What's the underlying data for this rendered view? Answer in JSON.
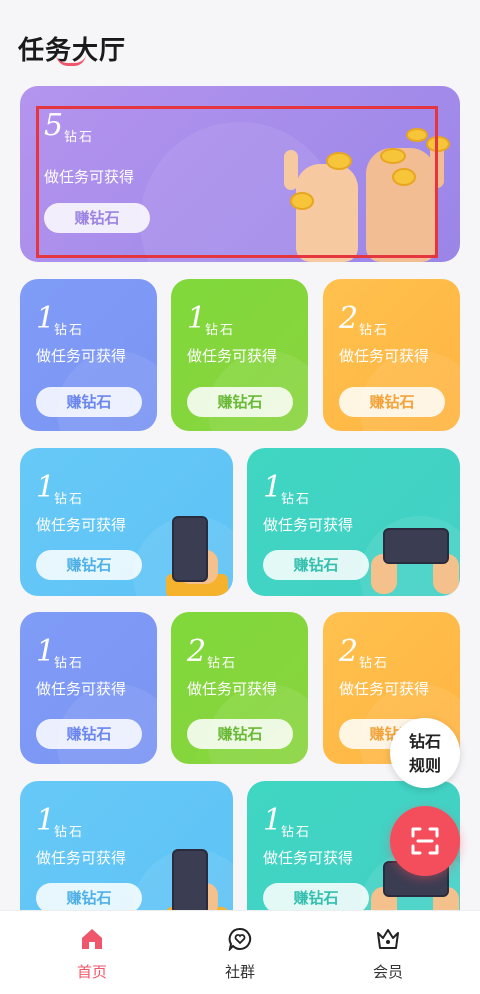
{
  "page": {
    "title": "任务大厅"
  },
  "banner": {
    "num": "5",
    "unit": "钻石",
    "desc": "做任务可获得",
    "btn": "赚钻石"
  },
  "cards": [
    {
      "num": "1",
      "unit": "钻石",
      "desc": "做任务可获得",
      "btn": "赚钻石"
    },
    {
      "num": "1",
      "unit": "钻石",
      "desc": "做任务可获得",
      "btn": "赚钻石"
    },
    {
      "num": "2",
      "unit": "钻石",
      "desc": "做任务可获得",
      "btn": "赚钻石"
    },
    {
      "num": "1",
      "unit": "钻石",
      "desc": "做任务可获得",
      "btn": "赚钻石"
    },
    {
      "num": "1",
      "unit": "钻石",
      "desc": "做任务可获得",
      "btn": "赚钻石"
    },
    {
      "num": "1",
      "unit": "钻石",
      "desc": "做任务可获得",
      "btn": "赚钻石"
    },
    {
      "num": "2",
      "unit": "钻石",
      "desc": "做任务可获得",
      "btn": "赚钻石"
    },
    {
      "num": "2",
      "unit": "钻石",
      "desc": "做任务可获得",
      "btn": "赚钻石"
    },
    {
      "num": "1",
      "unit": "钻石",
      "desc": "做任务可获得",
      "btn": "赚钻石"
    },
    {
      "num": "1",
      "unit": "钻石",
      "desc": "做任务可获得",
      "btn": "赚钻石"
    }
  ],
  "floating": {
    "rules_line1": "钻石",
    "rules_line2": "规则",
    "scan_icon": "scan-icon"
  },
  "tabs": [
    {
      "label": "首页",
      "icon": "home-icon",
      "active": true
    },
    {
      "label": "社群",
      "icon": "heart-chat-icon",
      "active": false
    },
    {
      "label": "会员",
      "icon": "crown-icon",
      "active": false
    }
  ],
  "colors": {
    "accent": "#f0566b",
    "scan": "#f44d5c",
    "highlight_frame": "#e5353f"
  }
}
